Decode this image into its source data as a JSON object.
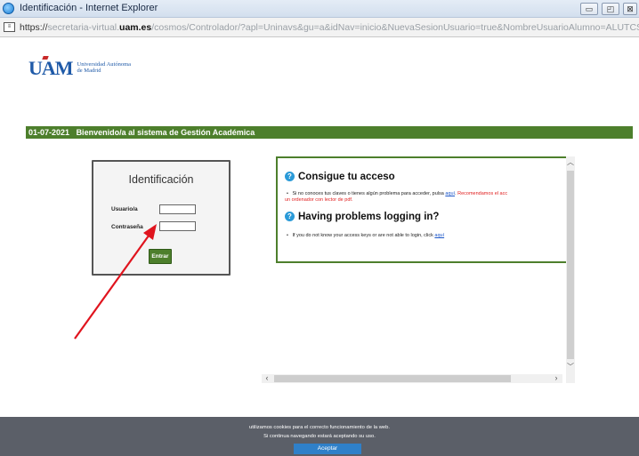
{
  "window": {
    "title": "Identificación - Internet Explorer",
    "buttons": {
      "minimize": "▭",
      "maximize": "◰",
      "close": "⊠"
    }
  },
  "address": {
    "protocol": "https://",
    "domain_prefix": "secretaria-virtual.",
    "domain": "uam.es",
    "path": "/cosmos/Controlador/?apl=Uninavs&gu=a&idNav=inicio&NuevaSesionUsuario=true&NombreUsuarioAlumno=ALUTCS"
  },
  "logo": {
    "mark": "UAM",
    "line1": "Universidad Autónoma",
    "line2": "de Madrid"
  },
  "banner": {
    "date": "01-07-2021",
    "welcome": "Bienvenido/a al sistema de Gestión Académica"
  },
  "login": {
    "heading": "Identificación",
    "user_label": "Usuario/a",
    "user_value": "",
    "password_label": "Contraseña",
    "password_value": "",
    "submit_label": "Entrar"
  },
  "info": {
    "es_heading": "Consigue tu acceso",
    "es_text": "Si no conoces tus claves o tienes algún problema para acceder, pulsa",
    "es_link": "aquí",
    "es_recommend": "Recomendamos el acc",
    "es_recommend_2": "un ordenador con lector de pdf.",
    "en_heading": "Having problems logging in?",
    "en_text": "If you do not know your access keys or are not able to login, click",
    "en_link": "aquí"
  },
  "cookie": {
    "line1": "utilizamos cookies para el correcto funcionamiento de la web.",
    "line2": "Si continua navegando estará aceptando su uso.",
    "accept_label": "Aceptar"
  },
  "colors": {
    "brand_green": "#4d7f2c",
    "brand_blue": "#1f5aa8",
    "link_blue": "#1a55c8",
    "arrow_red": "#e0141e",
    "cookie_bg": "#5b5f68",
    "accept_blue": "#2f80c9"
  },
  "icons": {
    "ie": "ie-logo-icon",
    "page": "page-icon",
    "help": "question-circle-icon",
    "arrow": "annotation-arrow"
  }
}
